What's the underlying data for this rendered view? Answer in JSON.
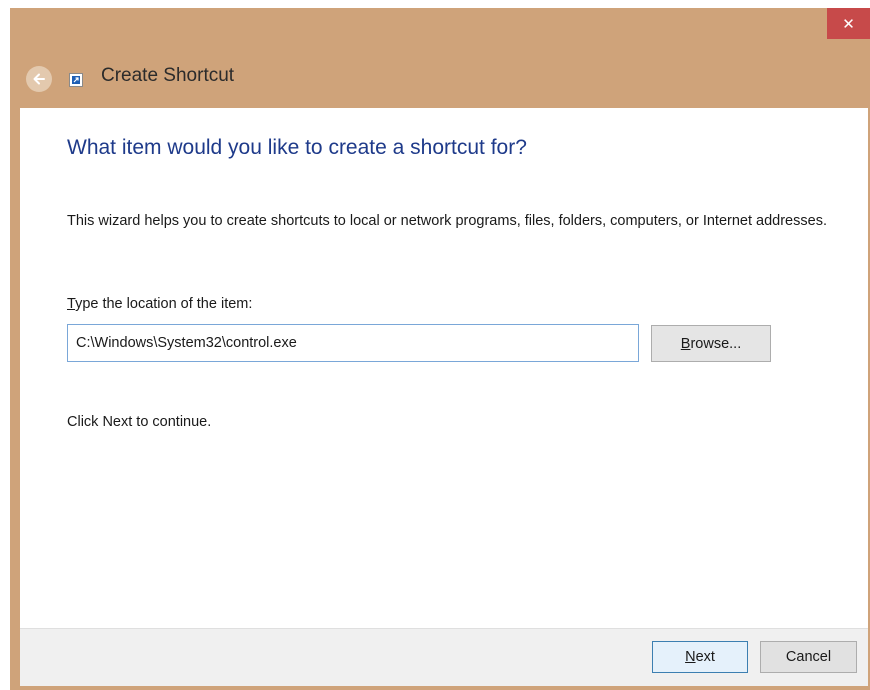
{
  "window": {
    "title": "Create Shortcut",
    "close_glyph": "✕",
    "frame_color": "#cfa37a",
    "close_color": "#c74a4a"
  },
  "icons": {
    "back": "back-arrow-icon",
    "shortcut": "shortcut-icon",
    "close": "close-icon"
  },
  "main": {
    "heading": "What item would you like to create a shortcut for?",
    "description": "This wizard helps you to create shortcuts to local or network programs, files, folders, computers, or Internet addresses.",
    "field_label_accesskey": "T",
    "field_label_rest": "ype the location of the item:",
    "location_value": "C:\\Windows\\System32\\control.exe",
    "browse_accesskey": "B",
    "browse_rest": "rowse...",
    "hint": "Click Next to continue."
  },
  "footer": {
    "next_accesskey": "N",
    "next_rest": "ext",
    "cancel_label": "Cancel"
  },
  "colors": {
    "heading": "#1e3a8a",
    "input_border": "#7aa7d8",
    "default_button_border": "#3c7fb1"
  }
}
